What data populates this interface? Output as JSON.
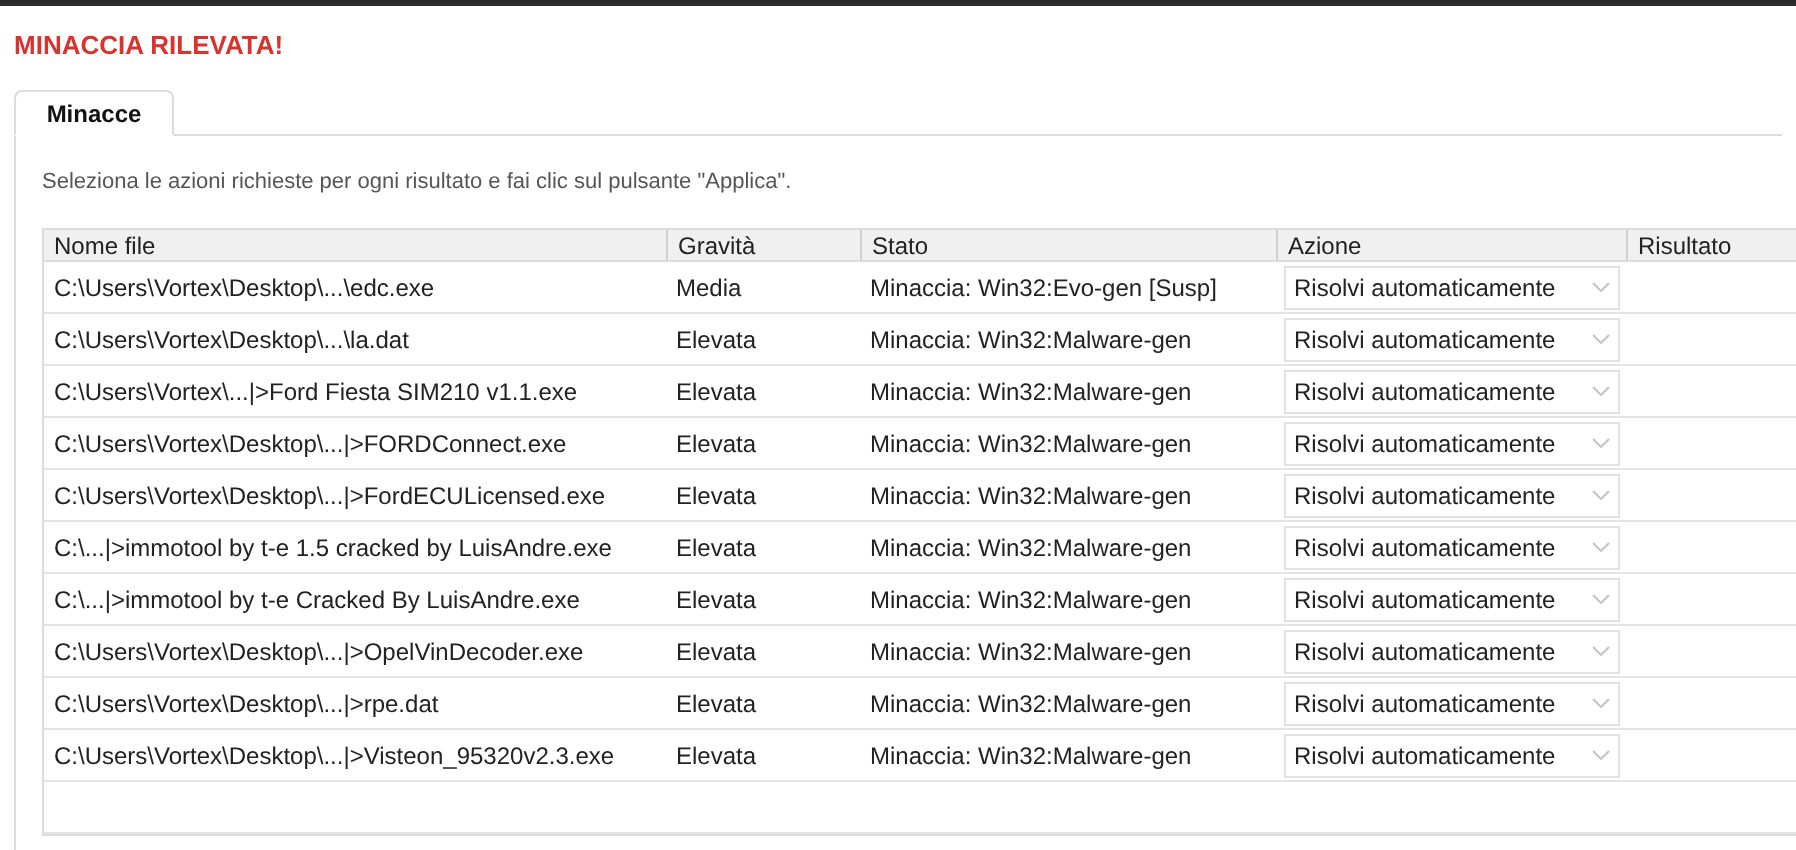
{
  "title": "MINACCIA RILEVATA!",
  "tabs": [
    {
      "label": "Minacce",
      "selected": true
    }
  ],
  "instruction": "Seleziona le azioni richieste per ogni risultato e fai clic sul pulsante \"Applica\".",
  "table": {
    "columns": [
      "Nome file",
      "Gravità",
      "Stato",
      "Azione",
      "Risultato"
    ],
    "rows": [
      {
        "file": "C:\\Users\\Vortex\\Desktop\\...\\edc.exe",
        "severity": "Media",
        "status": "Minaccia: Win32:Evo-gen [Susp]",
        "action": "Risolvi automaticamente"
      },
      {
        "file": "C:\\Users\\Vortex\\Desktop\\...\\la.dat",
        "severity": "Elevata",
        "status": "Minaccia: Win32:Malware-gen",
        "action": "Risolvi automaticamente"
      },
      {
        "file": "C:\\Users\\Vortex\\...|>Ford Fiesta SIM210 v1.1.exe",
        "severity": "Elevata",
        "status": "Minaccia: Win32:Malware-gen",
        "action": "Risolvi automaticamente"
      },
      {
        "file": "C:\\Users\\Vortex\\Desktop\\...|>FORDConnect.exe",
        "severity": "Elevata",
        "status": "Minaccia: Win32:Malware-gen",
        "action": "Risolvi automaticamente"
      },
      {
        "file": "C:\\Users\\Vortex\\Desktop\\...|>FordECULicensed.exe",
        "severity": "Elevata",
        "status": "Minaccia: Win32:Malware-gen",
        "action": "Risolvi automaticamente"
      },
      {
        "file": "C:\\...|>immotool by t-e 1.5 cracked by LuisAndre.exe",
        "severity": "Elevata",
        "status": "Minaccia: Win32:Malware-gen",
        "action": "Risolvi automaticamente"
      },
      {
        "file": "C:\\...|>immotool by t-e Cracked By LuisAndre.exe",
        "severity": "Elevata",
        "status": "Minaccia: Win32:Malware-gen",
        "action": "Risolvi automaticamente"
      },
      {
        "file": "C:\\Users\\Vortex\\Desktop\\...|>OpelVinDecoder.exe",
        "severity": "Elevata",
        "status": "Minaccia: Win32:Malware-gen",
        "action": "Risolvi automaticamente"
      },
      {
        "file": "C:\\Users\\Vortex\\Desktop\\...|>rpe.dat",
        "severity": "Elevata",
        "status": "Minaccia: Win32:Malware-gen",
        "action": "Risolvi automaticamente"
      },
      {
        "file": "C:\\Users\\Vortex\\Desktop\\...|>Visteon_95320v2.3.exe",
        "severity": "Elevata",
        "status": "Minaccia: Win32:Malware-gen",
        "action": "Risolvi automaticamente"
      }
    ]
  }
}
